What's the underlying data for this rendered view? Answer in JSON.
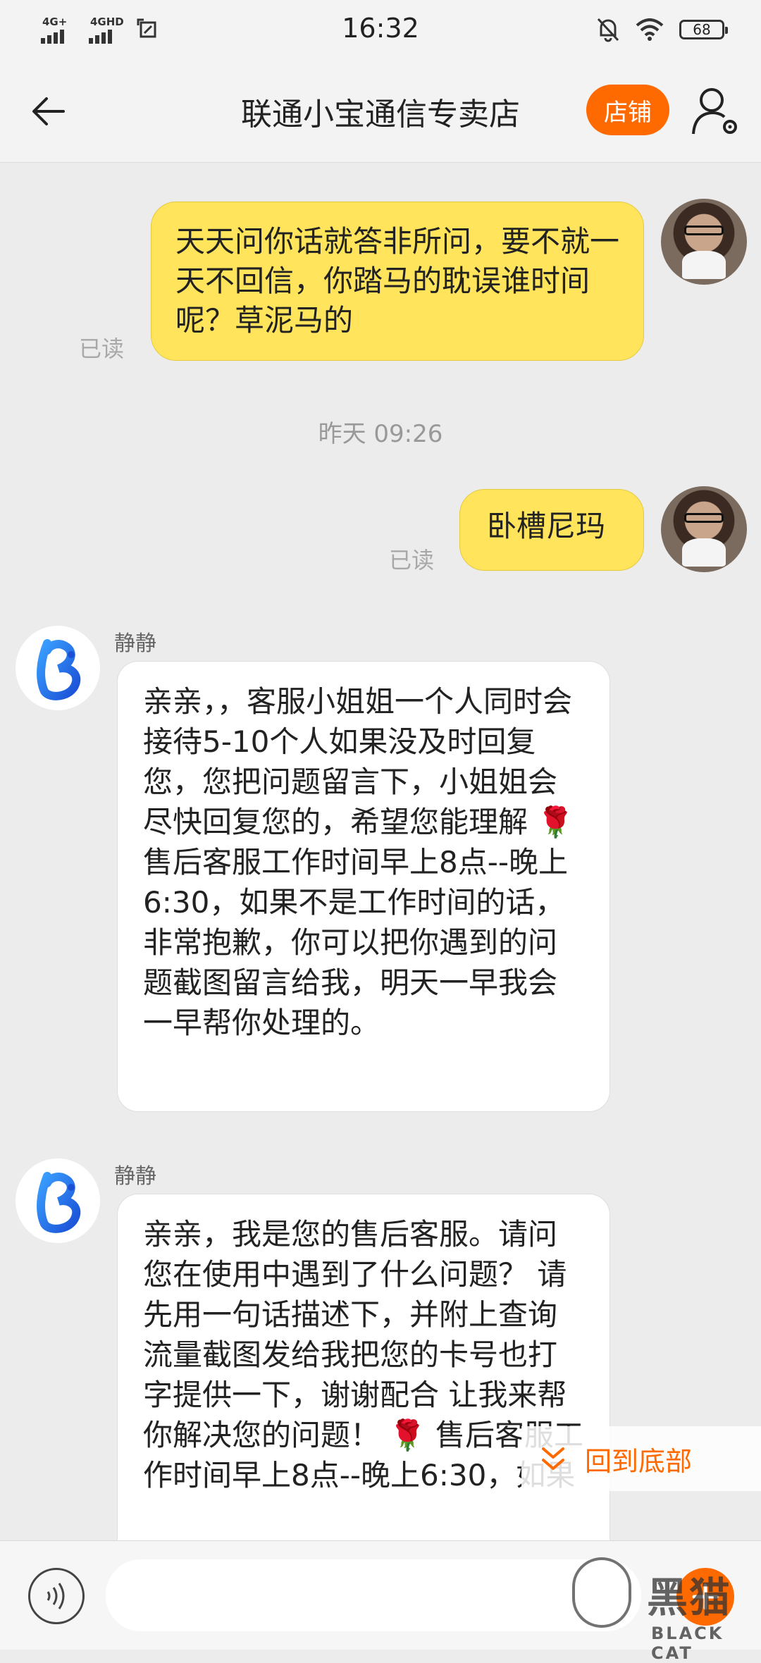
{
  "status_bar": {
    "network1": "4G+",
    "network2": "4GHD",
    "time": "16:32",
    "battery": "68"
  },
  "header": {
    "title": "联通小宝通信专卖店",
    "shop_label": "店铺"
  },
  "messages": [
    {
      "side": "me",
      "text": "天天问你话就答非所问，要不就一天不回信，你踏马的耽误谁时间呢？草泥马的",
      "read": "已读"
    },
    {
      "side": "me",
      "text": "卧槽尼玛",
      "read": "已读"
    },
    {
      "side": "shop",
      "sender": "静静",
      "text": "亲亲，，客服小姐姐一个人同时会接待5-10个人如果没及时回复您，您把问题留言下，小姐姐会尽快回复您的，希望您能理解 🌹 售后客服工作时间早上8点--晚上6:30，如果不是工作时间的话， 非常抱歉，你可以把你遇到的问题截图留言给我，明天一早我会一早帮你处理的。"
    },
    {
      "side": "shop",
      "sender": "静静",
      "text": "亲亲，我是您的售后客服。请问您在使用中遇到了什么问题？ 请先用一句话描述下，并附上查询流量截图发给我把您的卡号也打字提供一下，谢谢配合 让我来帮你解决您的问题！ 🌹 售后客服工作时间早上8点--晚上6:30，如果"
    }
  ],
  "time_separator": "昨天  09:26",
  "scroll_to_bottom": "回到底部",
  "input": {
    "placeholder": ""
  },
  "watermark": {
    "cn": "黑猫",
    "en": "BLACK CAT"
  },
  "colors": {
    "accent": "#ff6a00",
    "my_bubble": "#ffe45c",
    "background": "#ececec"
  }
}
